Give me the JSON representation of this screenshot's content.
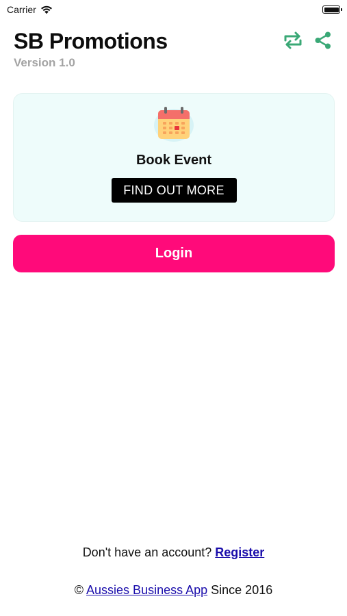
{
  "status_bar": {
    "carrier": "Carrier",
    "wifi_icon": "wifi-icon",
    "battery_icon": "battery-icon",
    "battery_level": 1.0
  },
  "header": {
    "title": "SB Promotions",
    "version": "Version 1.0",
    "actions": [
      {
        "icon": "repeat-icon",
        "color": "#3aa876"
      },
      {
        "icon": "share-icon",
        "color": "#3aa876"
      }
    ]
  },
  "event_card": {
    "icon": "calendar-icon",
    "title": "Book Event",
    "button_label": "FIND OUT MORE",
    "background": "#eefcfb"
  },
  "login": {
    "label": "Login",
    "color": "#ff0a7a"
  },
  "footer": {
    "register_prompt": "Don't have an account?",
    "register_link": "Register",
    "copyright_symbol": "©",
    "company_link": "Aussies Business App",
    "since_text": "Since 2016",
    "link_color": "#1a0dab"
  }
}
